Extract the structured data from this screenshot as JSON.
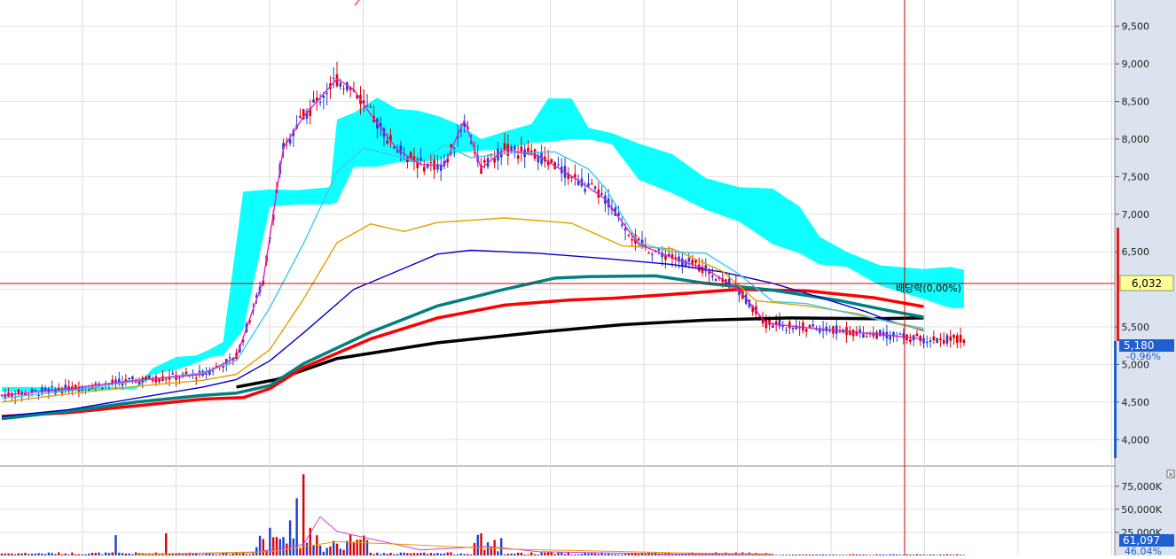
{
  "chart_data": [
    {
      "type": "candlestick",
      "panel": "price",
      "y_ticks": [
        "9,500",
        "9,000",
        "8,500",
        "8,000",
        "7,500",
        "7,000",
        "6,500",
        "5,500",
        "5,000",
        "4,500",
        "4,000"
      ],
      "y_tick_values": [
        9500,
        9000,
        8500,
        8000,
        7500,
        7000,
        6500,
        5500,
        5000,
        4500,
        4000
      ],
      "ylim": [
        3650,
        9850
      ],
      "crosshair_price": "6,032",
      "crosshair_value": 6032,
      "current_price": "5,180",
      "current_value": 5180,
      "change_pct": "-0.96%",
      "annotation": "배당락(0,00%)",
      "top_annotation": "\u0000",
      "ichimoku_cloud": {
        "color": "#00ffff",
        "points": [
          [
            0,
            4700,
            4640
          ],
          [
            10,
            4700,
            4640
          ],
          [
            20,
            4690,
            4640
          ],
          [
            30,
            4700,
            4660
          ],
          [
            40,
            4700,
            4670
          ],
          [
            45,
            4950,
            4870
          ],
          [
            52,
            5100,
            4930
          ],
          [
            58,
            5120,
            5020
          ],
          [
            62,
            5200,
            5100
          ],
          [
            66,
            5300,
            5120
          ],
          [
            72,
            7300,
            5460
          ],
          [
            80,
            7330,
            7100
          ],
          [
            88,
            7320,
            7130
          ],
          [
            98,
            7360,
            7130
          ],
          [
            100,
            8260,
            7160
          ],
          [
            105,
            8350,
            7630
          ],
          [
            112,
            8550,
            7630
          ],
          [
            118,
            8400,
            7690
          ],
          [
            124,
            8380,
            7690
          ],
          [
            130,
            8310,
            7720
          ],
          [
            136,
            8200,
            7820
          ],
          [
            143,
            8000,
            7850
          ],
          [
            150,
            8100,
            7860
          ],
          [
            158,
            8200,
            7950
          ],
          [
            163,
            8540,
            7960
          ],
          [
            170,
            8540,
            8000
          ],
          [
            175,
            8150,
            8000
          ],
          [
            182,
            8080,
            7930
          ],
          [
            190,
            7940,
            7460
          ],
          [
            200,
            7800,
            7280
          ],
          [
            210,
            7480,
            7060
          ],
          [
            220,
            7360,
            6900
          ],
          [
            230,
            7340,
            6600
          ],
          [
            238,
            7100,
            6480
          ],
          [
            244,
            6700,
            6330
          ],
          [
            252,
            6500,
            6300
          ],
          [
            262,
            6320,
            6050
          ],
          [
            275,
            6270,
            5870
          ],
          [
            283,
            6300,
            5750
          ],
          [
            287,
            6260,
            5750
          ]
        ]
      },
      "moving_averages": [
        {
          "color": "#000000",
          "points": [
            [
              70,
              4700
            ],
            [
              82,
              4800
            ],
            [
              100,
              5080
            ],
            [
              130,
              5290
            ],
            [
              160,
              5430
            ],
            [
              185,
              5530
            ],
            [
              210,
              5590
            ],
            [
              235,
              5620
            ],
            [
              260,
              5610
            ],
            [
              275,
              5620
            ]
          ]
        },
        {
          "color": "#ff0000",
          "points": [
            [
              0,
              4310
            ],
            [
              20,
              4360
            ],
            [
              40,
              4450
            ],
            [
              60,
              4540
            ],
            [
              72,
              4560
            ],
            [
              80,
              4680
            ],
            [
              90,
              4960
            ],
            [
              110,
              5340
            ],
            [
              130,
              5620
            ],
            [
              150,
              5790
            ],
            [
              170,
              5860
            ],
            [
              182,
              5880
            ],
            [
              205,
              5950
            ],
            [
              220,
              6000
            ],
            [
              240,
              5980
            ],
            [
              260,
              5890
            ],
            [
              275,
              5770
            ]
          ]
        },
        {
          "color": "#008080",
          "points": [
            [
              0,
              4280
            ],
            [
              20,
              4380
            ],
            [
              40,
              4500
            ],
            [
              60,
              4590
            ],
            [
              70,
              4620
            ],
            [
              80,
              4720
            ],
            [
              90,
              5010
            ],
            [
              110,
              5430
            ],
            [
              130,
              5780
            ],
            [
              150,
              6000
            ],
            [
              165,
              6150
            ],
            [
              175,
              6170
            ],
            [
              195,
              6180
            ],
            [
              210,
              6080
            ],
            [
              230,
              5990
            ],
            [
              250,
              5850
            ],
            [
              262,
              5740
            ],
            [
              275,
              5630
            ]
          ]
        },
        {
          "color": "#0000cc",
          "points": [
            [
              0,
              4310
            ],
            [
              20,
              4400
            ],
            [
              40,
              4550
            ],
            [
              60,
              4700
            ],
            [
              70,
              4800
            ],
            [
              80,
              5050
            ],
            [
              90,
              5420
            ],
            [
              105,
              6000
            ],
            [
              120,
              6280
            ],
            [
              130,
              6470
            ],
            [
              140,
              6520
            ],
            [
              160,
              6480
            ],
            [
              180,
              6410
            ],
            [
              200,
              6330
            ],
            [
              215,
              6230
            ],
            [
              230,
              6080
            ],
            [
              245,
              5880
            ],
            [
              258,
              5700
            ],
            [
              265,
              5580
            ],
            [
              275,
              5450
            ]
          ]
        },
        {
          "color": "#e0a000",
          "points": [
            [
              0,
              4500
            ],
            [
              20,
              4610
            ],
            [
              40,
              4710
            ],
            [
              60,
              4790
            ],
            [
              70,
              4870
            ],
            [
              80,
              5200
            ],
            [
              90,
              5870
            ],
            [
              100,
              6620
            ],
            [
              110,
              6870
            ],
            [
              120,
              6770
            ],
            [
              130,
              6890
            ],
            [
              140,
              6920
            ],
            [
              150,
              6950
            ],
            [
              170,
              6880
            ],
            [
              185,
              6580
            ],
            [
              200,
              6540
            ],
            [
              215,
              6240
            ],
            [
              225,
              5850
            ],
            [
              240,
              5780
            ],
            [
              255,
              5680
            ],
            [
              265,
              5560
            ],
            [
              275,
              5460
            ]
          ]
        },
        {
          "color": "#40c8f0",
          "points": [
            [
              0,
              4550
            ],
            [
              20,
              4650
            ],
            [
              40,
              4780
            ],
            [
              60,
              4890
            ],
            [
              70,
              5050
            ],
            [
              80,
              5760
            ],
            [
              90,
              6610
            ],
            [
              100,
              7560
            ],
            [
              108,
              7880
            ],
            [
              115,
              7800
            ],
            [
              125,
              7700
            ],
            [
              132,
              7920
            ],
            [
              140,
              7750
            ],
            [
              150,
              7810
            ],
            [
              165,
              7830
            ],
            [
              175,
              7600
            ],
            [
              180,
              7350
            ],
            [
              190,
              6620
            ],
            [
              200,
              6500
            ],
            [
              210,
              6480
            ],
            [
              220,
              6200
            ],
            [
              230,
              5840
            ],
            [
              240,
              5810
            ],
            [
              255,
              5660
            ],
            [
              265,
              5570
            ],
            [
              275,
              5480
            ]
          ]
        },
        {
          "color": "#e020d0",
          "points": [
            [
              0,
              4590
            ],
            [
              20,
              4680
            ],
            [
              40,
              4790
            ],
            [
              60,
              4870
            ],
            [
              70,
              5100
            ],
            [
              78,
              6120
            ],
            [
              84,
              7880
            ],
            [
              90,
              8300
            ],
            [
              100,
              8800
            ],
            [
              105,
              8660
            ],
            [
              110,
              8330
            ],
            [
              118,
              7860
            ],
            [
              125,
              7660
            ],
            [
              132,
              7650
            ],
            [
              138,
              8250
            ],
            [
              143,
              7610
            ],
            [
              150,
              7860
            ],
            [
              160,
              7780
            ],
            [
              172,
              7450
            ],
            [
              180,
              7200
            ],
            [
              190,
              6600
            ],
            [
              200,
              6420
            ],
            [
              210,
              6270
            ],
            [
              220,
              5990
            ],
            [
              228,
              5550
            ],
            [
              240,
              5490
            ],
            [
              250,
              5450
            ],
            [
              262,
              5400
            ],
            [
              275,
              5340
            ]
          ]
        }
      ]
    },
    {
      "type": "bar",
      "panel": "volume",
      "y_ticks": [
        "75,000K",
        "50,000K",
        "25,000K"
      ],
      "y_tick_values": [
        75000,
        50000,
        25000
      ],
      "ylim": [
        0,
        96000
      ],
      "current_volume": "61,097",
      "ratio": "46.04%"
    }
  ]
}
